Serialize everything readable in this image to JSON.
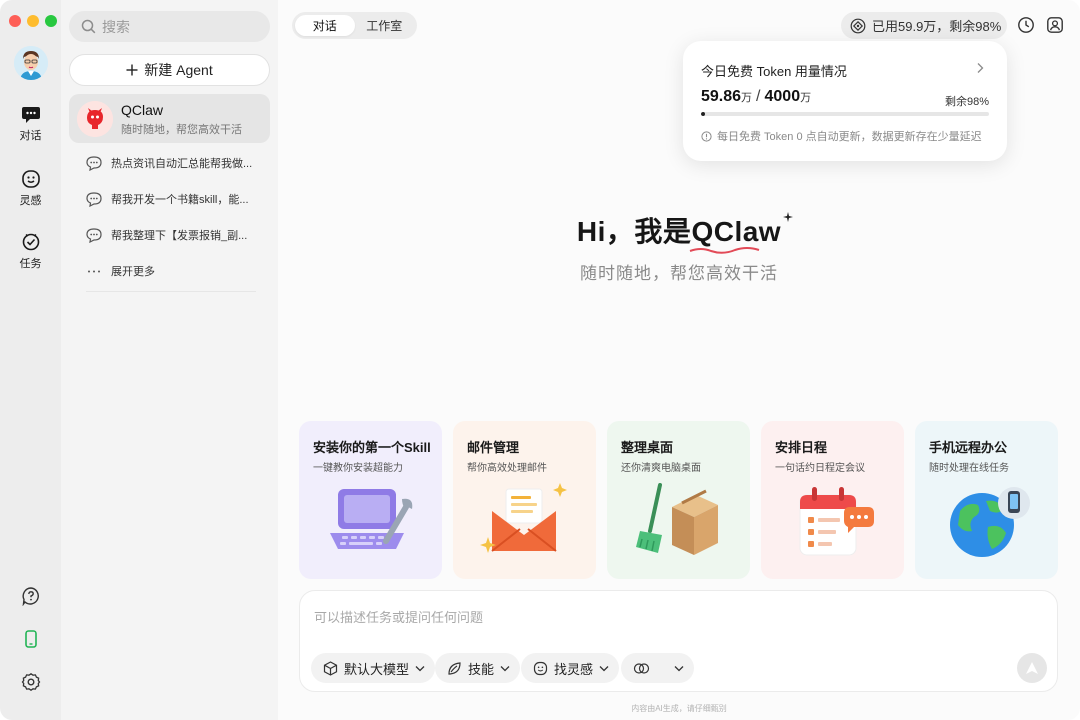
{
  "window": {
    "title": "QClaw"
  },
  "rail": {
    "items": [
      {
        "label": "对话",
        "icon": "chat-bubble-icon"
      },
      {
        "label": "灵感",
        "icon": "smile-face-icon"
      },
      {
        "label": "任务",
        "icon": "check-circle-icon"
      }
    ],
    "bottom_icons": [
      "help-icon",
      "phone-icon",
      "settings-icon"
    ],
    "accent": "#22b455"
  },
  "sidebar": {
    "search_placeholder": "搜索",
    "new_agent_label": "新建 Agent",
    "agent": {
      "name": "QClaw",
      "subtitle": "随时随地，帮您高效干活"
    },
    "history": [
      "热点资讯自动汇总能帮我做...",
      "帮我开发一个书籍skill，能...",
      "帮我整理下【发票报销_副..."
    ],
    "expand_label": "展开更多"
  },
  "header": {
    "tabs": [
      {
        "label": "对话",
        "active": true
      },
      {
        "label": "工作室",
        "active": false
      }
    ],
    "usage_pill": "已用59.9万，剩余98%"
  },
  "usage_popover": {
    "title": "今日免费 Token 用量情况",
    "used_value": "59.86",
    "used_unit": "万",
    "total_value": "4000",
    "total_unit": "万",
    "remaining": "剩余98%",
    "used_fraction": 0.015,
    "note": "每日免费 Token 0 点自动更新，数据更新存在少量延迟"
  },
  "hero": {
    "greeting": "Hi，我是",
    "brand": "QClaw",
    "subtitle": "随时随地，帮您高效干活"
  },
  "cards": [
    {
      "title": "安装你的第一个Skill",
      "subtitle": "一键教你安装超能力",
      "bg": "#f1eefc",
      "icon": "laptop-wrench-icon"
    },
    {
      "title": "邮件管理",
      "subtitle": "帮你高效处理邮件",
      "bg": "#fdf3ec",
      "icon": "envelope-icon"
    },
    {
      "title": "整理桌面",
      "subtitle": "还你清爽电脑桌面",
      "bg": "#eef7ef",
      "icon": "broom-box-icon"
    },
    {
      "title": "安排日程",
      "subtitle": "一句话约日程定会议",
      "bg": "#fdf0f0",
      "icon": "calendar-icon"
    },
    {
      "title": "手机远程办公",
      "subtitle": "随时处理在线任务",
      "bg": "#edf6f9",
      "icon": "globe-phone-icon"
    }
  ],
  "composer": {
    "placeholder": "可以描述任务或提问任何问题",
    "chips": [
      {
        "label": "默认大模型",
        "icon": "cube-icon"
      },
      {
        "label": "技能",
        "icon": "leaf-icon"
      },
      {
        "label": "找灵感",
        "icon": "smile-face-icon"
      },
      {
        "label": "",
        "icon": "link-icon"
      }
    ]
  },
  "footer_note": "内容由AI生成，请仔细甄别"
}
